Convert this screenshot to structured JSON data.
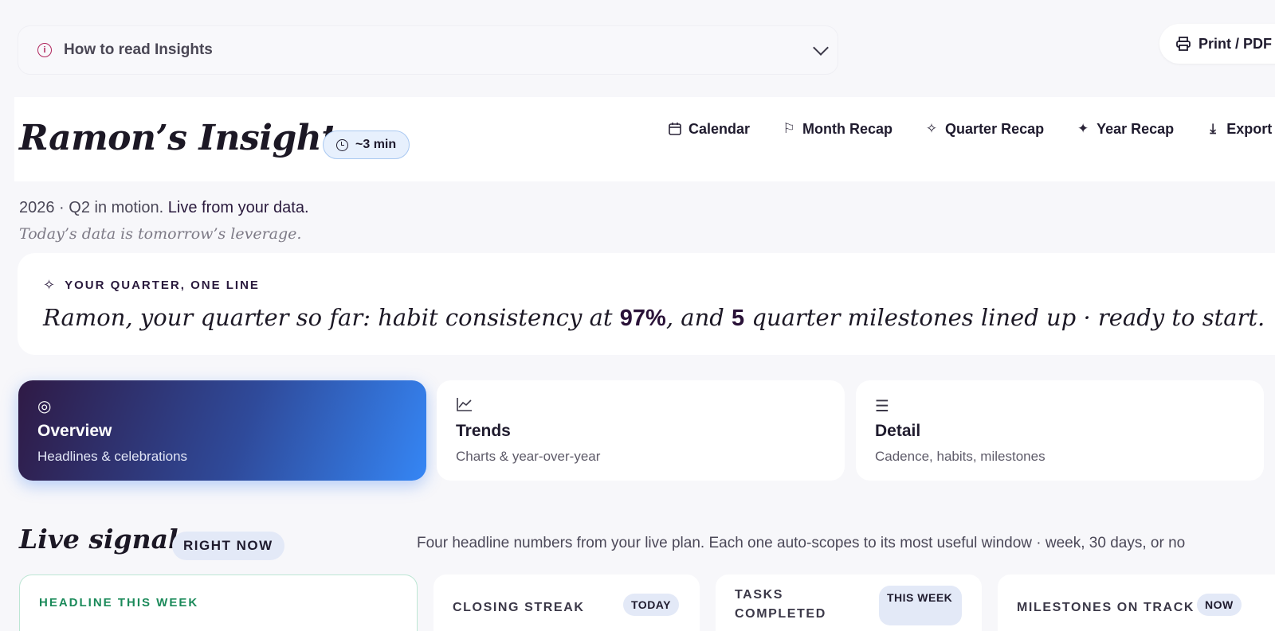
{
  "howto": {
    "label": "How to read Insights"
  },
  "print": {
    "label": "Print / PDF"
  },
  "header": {
    "title": "Ramon’s Insights",
    "read_time": "~3 min",
    "nav": [
      {
        "icon": "calendar-icon",
        "label": "Calendar"
      },
      {
        "icon": "party-popper-icon",
        "label": "Month Recap"
      },
      {
        "icon": "sparkle-icon",
        "label": "Quarter Recap"
      },
      {
        "icon": "star-icon",
        "label": "Year Recap"
      },
      {
        "icon": "download-icon",
        "label": "Export"
      }
    ]
  },
  "subline": {
    "period": "2026 · Q2 in motion.",
    "live": "Live from your data."
  },
  "tagline": "Today’s data is tomorrow’s leverage.",
  "quarter": {
    "kicker": "YOUR QUARTER, ONE LINE",
    "pre": "Ramon, your quarter so far: habit consistency at ",
    "consistency": "97%",
    "mid": ", and ",
    "milestones": "5",
    "post": " quarter milestones lined up · ready to start."
  },
  "modes": [
    {
      "name": "Overview",
      "desc": "Headlines & celebrations",
      "icon": "target-icon",
      "active": true
    },
    {
      "name": "Trends",
      "desc": "Charts & year-over-year",
      "icon": "trend-chart-icon",
      "active": false
    },
    {
      "name": "Detail",
      "desc": "Cadence, habits, milestones",
      "icon": "list-icon",
      "active": false
    }
  ],
  "live_signals": {
    "title": "Live signals",
    "badge": "RIGHT NOW",
    "desc": "Four headline numbers from your live plan. Each one auto-scopes to its most useful window · week, 30 days, or no",
    "cards": [
      {
        "title": "HEADLINE THIS WEEK"
      },
      {
        "title": "CLOSING STREAK",
        "pill": "TODAY"
      },
      {
        "title": "TASKS COMPLETED",
        "pill": "THIS WEEK"
      },
      {
        "title": "MILESTONES ON TRACK",
        "pill": "NOW"
      }
    ]
  },
  "colors": {
    "accent": "#3586f5",
    "brand_dark": "#2f1a45",
    "info": "#b0265d",
    "success": "#1b8a5a"
  }
}
